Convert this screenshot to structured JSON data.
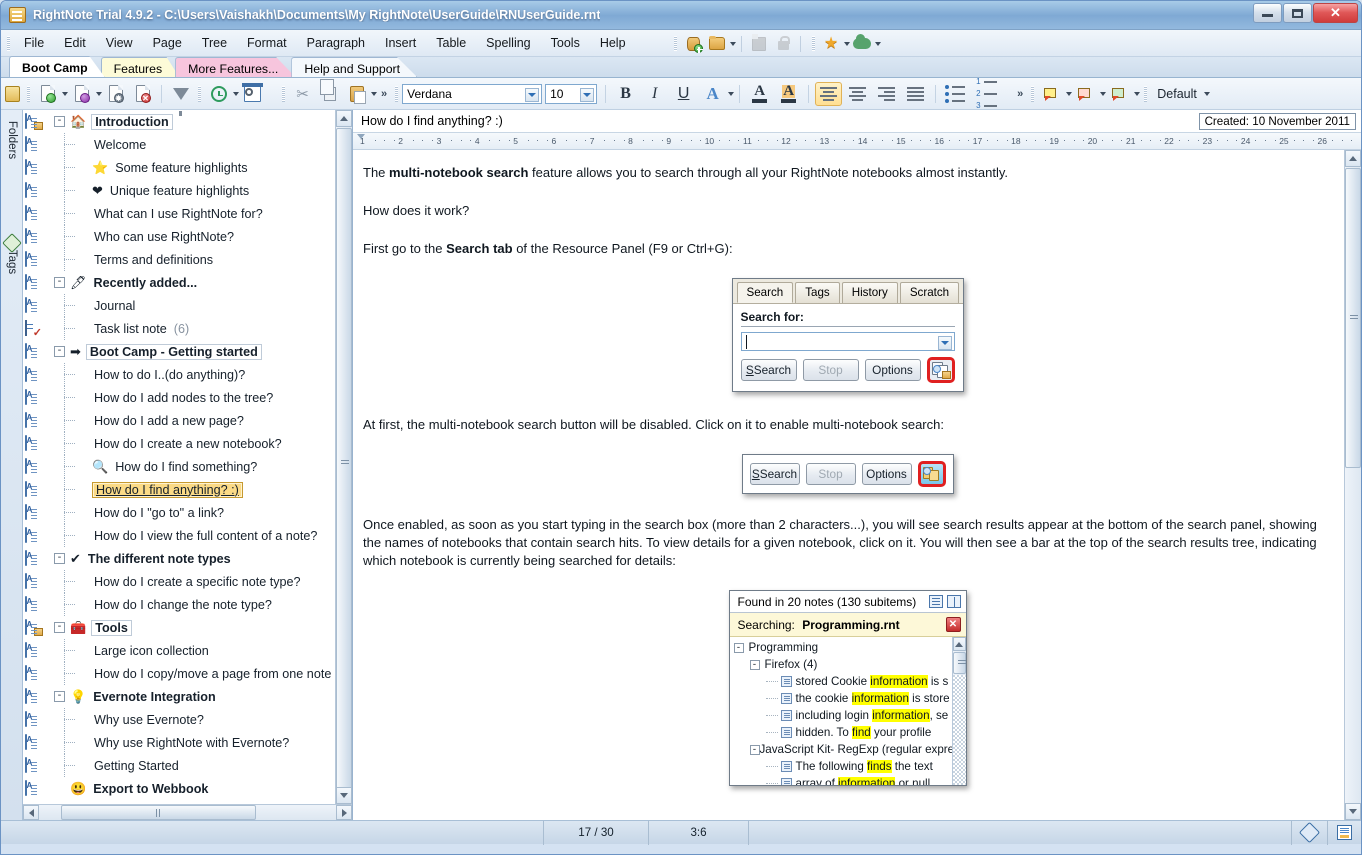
{
  "window": {
    "title": "RightNote Trial 4.9.2 - C:\\Users\\Vaishakh\\Documents\\My RightNote\\UserGuide\\RNUserGuide.rnt",
    "app_icon": "notebook-icon",
    "minimize": "minimize-icon",
    "maximize": "maximize-icon",
    "close": "close-icon"
  },
  "menu": {
    "items": [
      "File",
      "Edit",
      "View",
      "Page",
      "Tree",
      "Format",
      "Paragraph",
      "Insert",
      "Table",
      "Spelling",
      "Tools",
      "Help"
    ],
    "right_icons": [
      "new-notebook-icon",
      "open-notebook-icon",
      "save-icon",
      "lock-icon",
      "favorites-star-icon",
      "cloud-sync-icon"
    ]
  },
  "notebook_tabs": [
    {
      "label": "Boot Camp",
      "active": true,
      "color": "#ffffff"
    },
    {
      "label": "Features",
      "active": false,
      "color": "#fdfbd8"
    },
    {
      "label": "More Features...",
      "active": false,
      "color": "#f7c5dd"
    },
    {
      "label": "Help and Support",
      "active": false,
      "color": "#f4f8fc"
    }
  ],
  "toolbar": {
    "icons_left": [
      "new-page-icon",
      "new-note-icon",
      "page-properties-icon",
      "delete-page-icon",
      "filter-icon",
      "history-icon",
      "settings-icon"
    ],
    "icons_clip": [
      "cut-icon",
      "copy-icon",
      "paste-icon"
    ],
    "overflow": "»",
    "font_name": "Verdana",
    "font_size": "10",
    "bold": "B",
    "italic": "I",
    "underline": "U",
    "font_effects": "A",
    "font_color": "font-color-icon",
    "highlight_color": "highlight-color-icon",
    "align_left": "align-left-icon",
    "align_center": "align-center-icon",
    "align_right": "align-right-icon",
    "align_justify": "align-justify-icon",
    "bullet_list": "bullet-list-icon",
    "numbered_list": "numbered-list-icon",
    "highlighters": [
      "highlight-yellow-icon",
      "highlight-red-icon",
      "highlight-green-icon"
    ],
    "style_name": "Default"
  },
  "side_tabs": [
    {
      "label": "Folders",
      "icon": "folders-icon"
    },
    {
      "label": "Tags",
      "icon": "tag-icon"
    }
  ],
  "tree": {
    "items": [
      {
        "label": "Introduction",
        "level": 0,
        "bold": true,
        "expander": "-",
        "icon": "home-icon",
        "emoji": "🏠",
        "boxed": true,
        "node": "folder"
      },
      {
        "label": "Welcome",
        "level": 1,
        "node": "page"
      },
      {
        "label": "Some feature highlights",
        "level": 1,
        "emoji": "⭐",
        "node": "page"
      },
      {
        "label": "Unique feature highlights",
        "level": 1,
        "emoji": "❤",
        "node": "page"
      },
      {
        "label": "What can I use RightNote for?",
        "level": 1,
        "node": "page"
      },
      {
        "label": "Who can use RightNote?",
        "level": 1,
        "node": "page"
      },
      {
        "label": "Terms and definitions",
        "level": 1,
        "node": "page"
      },
      {
        "label": "Recently added...",
        "level": 0,
        "bold": true,
        "expander": "-",
        "emoji": "🖊",
        "node": "page"
      },
      {
        "label": "Journal",
        "level": 1,
        "node": "page"
      },
      {
        "label": "Task list note",
        "level": 1,
        "count": "(6)",
        "node": "task"
      },
      {
        "label": "Boot Camp - Getting started",
        "level": 0,
        "bold": true,
        "expander": "-",
        "emoji": "➡",
        "boxed": true,
        "node": "page"
      },
      {
        "label": "How to do I..(do anything)?",
        "level": 1,
        "node": "page"
      },
      {
        "label": "How do I add nodes to the tree?",
        "level": 1,
        "node": "page"
      },
      {
        "label": "How do I add a new page?",
        "level": 1,
        "node": "page"
      },
      {
        "label": "How do I create a new notebook?",
        "level": 1,
        "node": "page"
      },
      {
        "label": "How do I find something?",
        "level": 1,
        "emoji": "🔍",
        "node": "page"
      },
      {
        "label": "How do I find anything? :)",
        "level": 1,
        "selected": true,
        "node": "page"
      },
      {
        "label": "How do I \"go to\" a link?",
        "level": 1,
        "node": "page"
      },
      {
        "label": "How do I view the full content of a note?",
        "level": 1,
        "node": "page"
      },
      {
        "label": "The different note types",
        "level": 0,
        "bold": true,
        "expander": "-",
        "emoji": "✔",
        "node": "page"
      },
      {
        "label": "How do I create a specific note type?",
        "level": 1,
        "node": "page"
      },
      {
        "label": "How do I change the note type?",
        "level": 1,
        "node": "page"
      },
      {
        "label": "Tools",
        "level": 0,
        "bold": true,
        "expander": "-",
        "emoji": "🧰",
        "boxed": true,
        "node": "folder"
      },
      {
        "label": "Large icon collection",
        "level": 1,
        "node": "page"
      },
      {
        "label": "How do I copy/move a page from one note",
        "level": 1,
        "node": "page"
      },
      {
        "label": "Evernote Integration",
        "level": 0,
        "bold": true,
        "expander": "-",
        "emoji": "💡",
        "node": "page"
      },
      {
        "label": "Why use Evernote?",
        "level": 1,
        "node": "page"
      },
      {
        "label": "Why use RightNote with Evernote?",
        "level": 1,
        "node": "page"
      },
      {
        "label": "Getting Started",
        "level": 1,
        "node": "page"
      },
      {
        "label": "Export to Webbook",
        "level": 0,
        "bold": true,
        "emoji": "😃",
        "node": "page"
      }
    ]
  },
  "note": {
    "title": "How do I find anything? :)",
    "created_label": "Created: 10 November 2011",
    "ruler_numbers": [
      "1",
      "2",
      "3",
      "4",
      "5",
      "6",
      "7",
      "8",
      "9",
      "10",
      "11",
      "12",
      "13",
      "14",
      "15",
      "16",
      "17",
      "18",
      "19",
      "20",
      "21",
      "22",
      "23",
      "24",
      "25",
      "26"
    ],
    "paragraphs": [
      {
        "id": "p1",
        "pre": "The ",
        "bold": "multi-notebook search",
        "post": " feature allows you to search through all your RightNote notebooks almost instantly."
      },
      {
        "id": "p2",
        "pre": "How does it work?",
        "bold": "",
        "post": ""
      },
      {
        "id": "p3",
        "pre": "First go to the ",
        "bold": "Search tab",
        "post": " of the Resource Panel (F9 or Ctrl+G):"
      },
      {
        "id": "p4",
        "pre": "At first, the multi-notebook search button will be disabled. Click on it to enable multi-notebook search:",
        "bold": "",
        "post": ""
      },
      {
        "id": "p5",
        "pre": "Once enabled, as soon as you start typing in the search box (more than 2 characters...), you will see search results appear at the bottom of the search panel, showing the names of notebooks that contain search hits. To view details for a given notebook, click on it. You will then see a bar at the top of the search results tree, indicating which notebook is currently being searched for details:",
        "bold": "",
        "post": ""
      }
    ]
  },
  "screenshot_search_panel": {
    "tabs": [
      "Search",
      "Tags",
      "History",
      "Scratch"
    ],
    "active_tab": "Search",
    "field_label": "Search for:",
    "input_value": "",
    "buttons": [
      {
        "label": "Search",
        "disabled": false
      },
      {
        "label": "Stop",
        "disabled": true
      },
      {
        "label": "Options",
        "disabled": false
      }
    ],
    "multi_notebook_button": "multi-notebook-search-icon",
    "multi_notebook_enabled": false
  },
  "screenshot_buttons_enabled": {
    "buttons": [
      {
        "label": "Search",
        "disabled": false
      },
      {
        "label": "Stop",
        "disabled": true
      },
      {
        "label": "Options",
        "disabled": false
      }
    ],
    "multi_notebook_button": "multi-notebook-search-icon",
    "multi_notebook_enabled": true
  },
  "screenshot_results": {
    "header": "Found in 20 notes (130 subitems)",
    "header_icons": [
      "list-view-icon",
      "expand-all-icon"
    ],
    "searching_label": "Searching:",
    "searching_file": "Programming.rnt",
    "close_icon": "close-icon",
    "rows": [
      {
        "level": 0,
        "expander": "-",
        "text": "Programming",
        "type": "folder"
      },
      {
        "level": 1,
        "expander": "-",
        "text": "Firefox (4)",
        "type": "folder"
      },
      {
        "level": 2,
        "type": "note",
        "parts": [
          {
            "t": "stored Cookie ",
            "h": false
          },
          {
            "t": "information",
            "h": true
          },
          {
            "t": " is s",
            "h": false
          }
        ]
      },
      {
        "level": 2,
        "type": "note",
        "parts": [
          {
            "t": "the cookie ",
            "h": false
          },
          {
            "t": "information",
            "h": true
          },
          {
            "t": " is store",
            "h": false
          }
        ]
      },
      {
        "level": 2,
        "type": "note",
        "parts": [
          {
            "t": "including login ",
            "h": false
          },
          {
            "t": "information",
            "h": true
          },
          {
            "t": ", se",
            "h": false
          }
        ]
      },
      {
        "level": 2,
        "type": "note",
        "parts": [
          {
            "t": "hidden. To ",
            "h": false
          },
          {
            "t": "find",
            "h": true
          },
          {
            "t": " your profile",
            "h": false
          }
        ]
      },
      {
        "level": 1,
        "expander": "-",
        "text": "JavaScript Kit- RegExp (regular expre",
        "type": "folder"
      },
      {
        "level": 2,
        "type": "note",
        "parts": [
          {
            "t": "The following ",
            "h": false
          },
          {
            "t": "finds",
            "h": true
          },
          {
            "t": " the text",
            "h": false
          }
        ]
      },
      {
        "level": 2,
        "type": "note",
        "parts": [
          {
            "t": "array of ",
            "h": false
          },
          {
            "t": "information",
            "h": true
          },
          {
            "t": " or null",
            "h": false
          }
        ]
      }
    ]
  },
  "statusbar": {
    "page_position": "17 / 30",
    "cursor_position": "3:6",
    "icons": [
      "tag-icon",
      "note-view-icon"
    ]
  },
  "colors": {
    "accent": "#7fa9d4",
    "selection": "#fbda86",
    "highlight": "#ffff00",
    "tab_more_features": "#f7c5dd",
    "tab_features": "#fdfbd8",
    "red_annotation": "#e02020"
  }
}
